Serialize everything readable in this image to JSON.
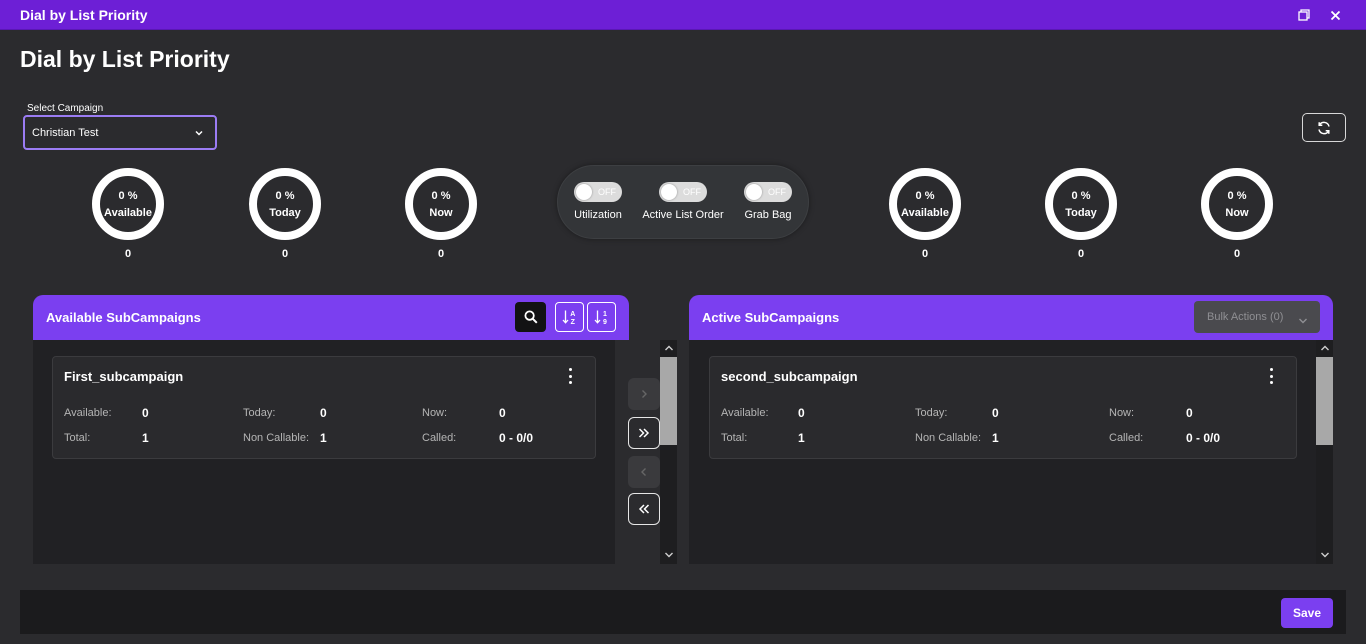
{
  "window": {
    "title": "Dial by List Priority"
  },
  "page": {
    "title": "Dial by List Priority"
  },
  "campaign_select": {
    "label": "Select Campaign",
    "value": "Christian Test"
  },
  "left_gauges": [
    {
      "pct": "0 %",
      "label": "Available",
      "count": "0"
    },
    {
      "pct": "0 %",
      "label": "Today",
      "count": "0"
    },
    {
      "pct": "0 %",
      "label": "Now",
      "count": "0"
    }
  ],
  "right_gauges": [
    {
      "pct": "0 %",
      "label": "Available",
      "count": "0"
    },
    {
      "pct": "0 %",
      "label": "Today",
      "count": "0"
    },
    {
      "pct": "0 %",
      "label": "Now",
      "count": "0"
    }
  ],
  "toggles": [
    {
      "label": "Utilization",
      "state": "OFF"
    },
    {
      "label": "Active List Order",
      "state": "OFF"
    },
    {
      "label": "Grab Bag",
      "state": "OFF"
    }
  ],
  "available_panel": {
    "title": "Available SubCampaigns",
    "cards": [
      {
        "name": "First_subcampaign",
        "available_label": "Available:",
        "available": "0",
        "today_label": "Today:",
        "today": "0",
        "now_label": "Now:",
        "now": "0",
        "total_label": "Total:",
        "total": "1",
        "noncallable_label": "Non Callable:",
        "noncallable": "1",
        "called_label": "Called:",
        "called": "0 - 0/0"
      }
    ]
  },
  "active_panel": {
    "title": "Active SubCampaigns",
    "bulk_label": "Bulk Actions (0)",
    "cards": [
      {
        "name": "second_subcampaign",
        "available_label": "Available:",
        "available": "0",
        "today_label": "Today:",
        "today": "0",
        "now_label": "Now:",
        "now": "0",
        "total_label": "Total:",
        "total": "1",
        "noncallable_label": "Non Callable:",
        "noncallable": "1",
        "called_label": "Called:",
        "called": "0 - 0/0"
      }
    ]
  },
  "footer": {
    "save_label": "Save"
  },
  "colors": {
    "accent": "#7b3ff0",
    "titlebar": "#6d1fd6",
    "background": "#2b2b2e",
    "panel_body": "#212124"
  },
  "icons": [
    "restore-window-icon",
    "close-icon",
    "chevron-down-icon",
    "refresh-icon",
    "search-icon",
    "sort-alpha-icon",
    "sort-numeric-icon",
    "move-right-icon",
    "move-all-right-icon",
    "move-left-icon",
    "move-all-left-icon",
    "kebab-menu-icon"
  ]
}
